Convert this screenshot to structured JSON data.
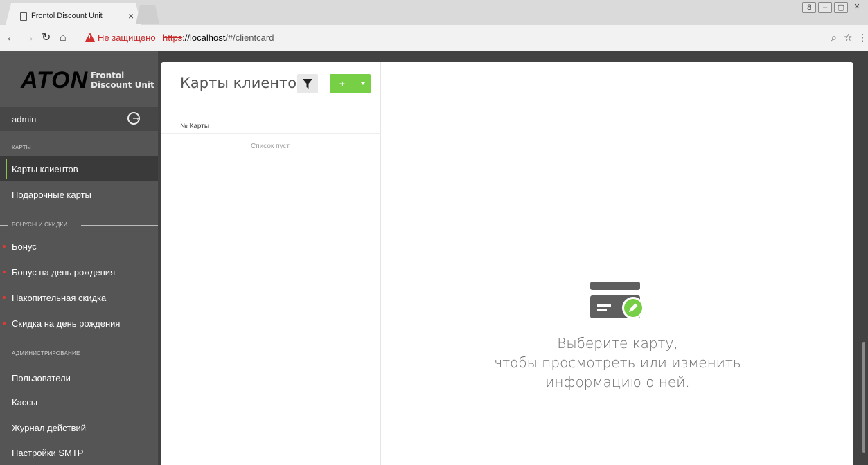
{
  "browser": {
    "tab_title": "Frontol Discount Unit",
    "tab_close": "×",
    "security_warning": "Не защищено",
    "url_scheme": "https",
    "url_host": "://localhost",
    "url_path": "/#/clientcard",
    "window_buttons": [
      "8",
      "–",
      "▢",
      "✕"
    ]
  },
  "sidebar": {
    "logo_text": "ATON",
    "logo_sub_line1": "Frontol",
    "logo_sub_line2": "Discount Unit",
    "user": "admin",
    "sections": {
      "cards": "КАРТЫ",
      "bonuses": "БОНУСЫ И СКИДКИ",
      "admin": "АДМИНИСТРИРОВАНИЕ"
    },
    "items": [
      {
        "label": "Карты клиентов",
        "active": true
      },
      {
        "label": "Подарочные карты"
      },
      {
        "label": "Бонус"
      },
      {
        "label": "Бонус на день рождения"
      },
      {
        "label": "Накопительная скидка"
      },
      {
        "label": "Скидка на день рождения"
      },
      {
        "label": "Пользователи"
      },
      {
        "label": "Кассы"
      },
      {
        "label": "Журнал действий"
      },
      {
        "label": "Настройки SMTP"
      }
    ]
  },
  "list": {
    "title": "Карты клиентов",
    "add_label": "+",
    "column_header": "№ Карты",
    "empty": "Список пуст"
  },
  "detail": {
    "hint_line1": "Выберите карту,",
    "hint_line2": "чтобы просмотреть или изменить",
    "hint_line3": "информацию о ней."
  },
  "colors": {
    "accent": "#76cf44",
    "sidebar_bg": "#555555",
    "alert": "#e53935"
  }
}
